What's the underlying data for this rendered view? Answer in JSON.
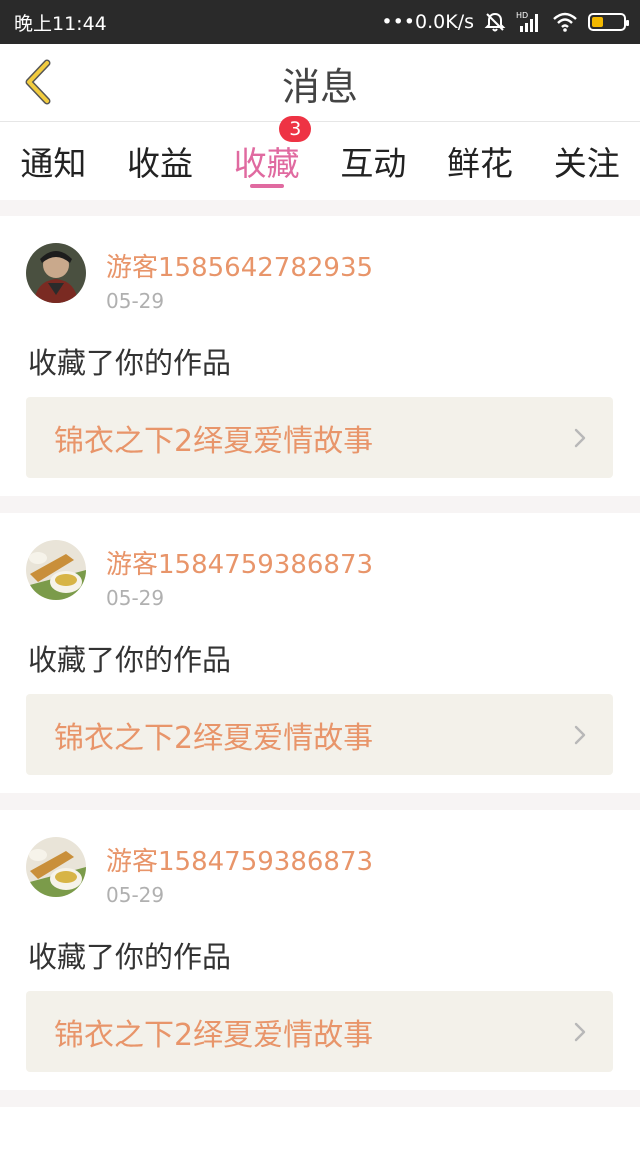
{
  "status_bar": {
    "time": "晚上11:44",
    "network_speed": "0.0K/s",
    "dots": "•••",
    "icons": [
      "alarm-off-icon",
      "hd-signal-icon",
      "wifi-icon",
      "battery-icon"
    ],
    "battery_level": 0.35
  },
  "header": {
    "title": "消息",
    "back_icon": "chevron-left-icon"
  },
  "tabs": [
    {
      "label": "通知",
      "active": false
    },
    {
      "label": "收益",
      "active": false
    },
    {
      "label": "收藏",
      "active": true,
      "badge": "3"
    },
    {
      "label": "互动",
      "active": false
    },
    {
      "label": "鲜花",
      "active": false
    },
    {
      "label": "关注",
      "active": false
    }
  ],
  "messages": [
    {
      "username": "游客1585642782935",
      "date": "05-29",
      "action": "收藏了你的作品",
      "work_title": "锦衣之下2绎夏爱情故事"
    },
    {
      "username": "游客1584759386873",
      "date": "05-29",
      "action": "收藏了你的作品",
      "work_title": "锦衣之下2绎夏爱情故事"
    },
    {
      "username": "游客1584759386873",
      "date": "05-29",
      "action": "收藏了你的作品",
      "work_title": "锦衣之下2绎夏爱情故事"
    }
  ],
  "colors": {
    "accent": "#e06aa0",
    "username": "#e8956a",
    "badge": "#ee3344",
    "back_arrow": "#e8c040"
  }
}
